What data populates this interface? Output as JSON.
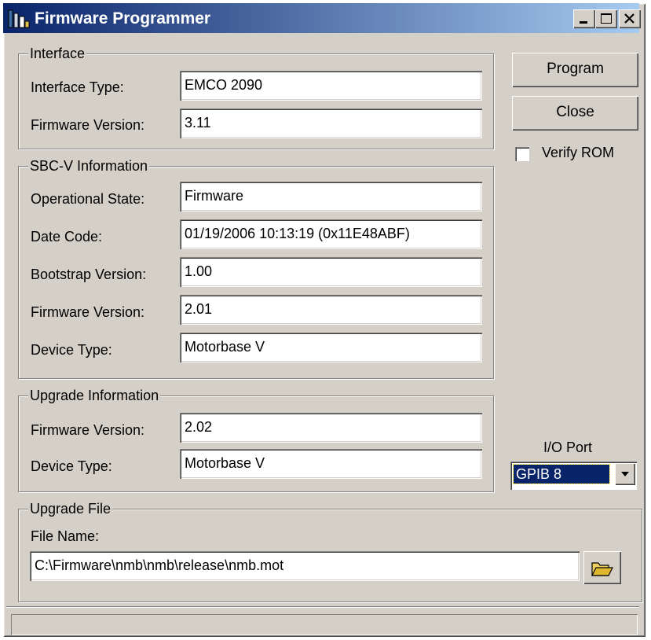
{
  "window": {
    "title": "Firmware Programmer"
  },
  "interface": {
    "group_label": "Interface",
    "type_label": "Interface Type:",
    "type_value": "EMCO 2090",
    "fw_label": "Firmware Version:",
    "fw_value": "3.11"
  },
  "sbc": {
    "group_label": "SBC-V Information",
    "state_label": "Operational State:",
    "state_value": "Firmware",
    "date_label": "Date Code:",
    "date_value": "01/19/2006 10:13:19 (0x11E48ABF)",
    "boot_label": "Bootstrap Version:",
    "boot_value": "1.00",
    "fw_label": "Firmware Version:",
    "fw_value": "2.01",
    "dev_label": "Device Type:",
    "dev_value": "Motorbase V"
  },
  "upgrade": {
    "group_label": "Upgrade Information",
    "fw_label": "Firmware Version:",
    "fw_value": "2.02",
    "dev_label": "Device Type:",
    "dev_value": "Motorbase V"
  },
  "upgrade_file": {
    "group_label": "Upgrade File",
    "name_label": "File Name:",
    "path_value": "C:\\Firmware\\nmb\\nmb\\release\\nmb.mot"
  },
  "actions": {
    "program_label": "Program",
    "close_label": "Close",
    "verify_label": "Verify ROM",
    "verify_checked": false
  },
  "io_port": {
    "label": "I/O Port",
    "selected": "GPIB 8"
  },
  "status_bar": {
    "text": ""
  },
  "colors": {
    "titlebar_start": "#0a246a",
    "titlebar_end": "#a6caf0",
    "face": "#d4d0c8",
    "selection": "#0a246a"
  }
}
